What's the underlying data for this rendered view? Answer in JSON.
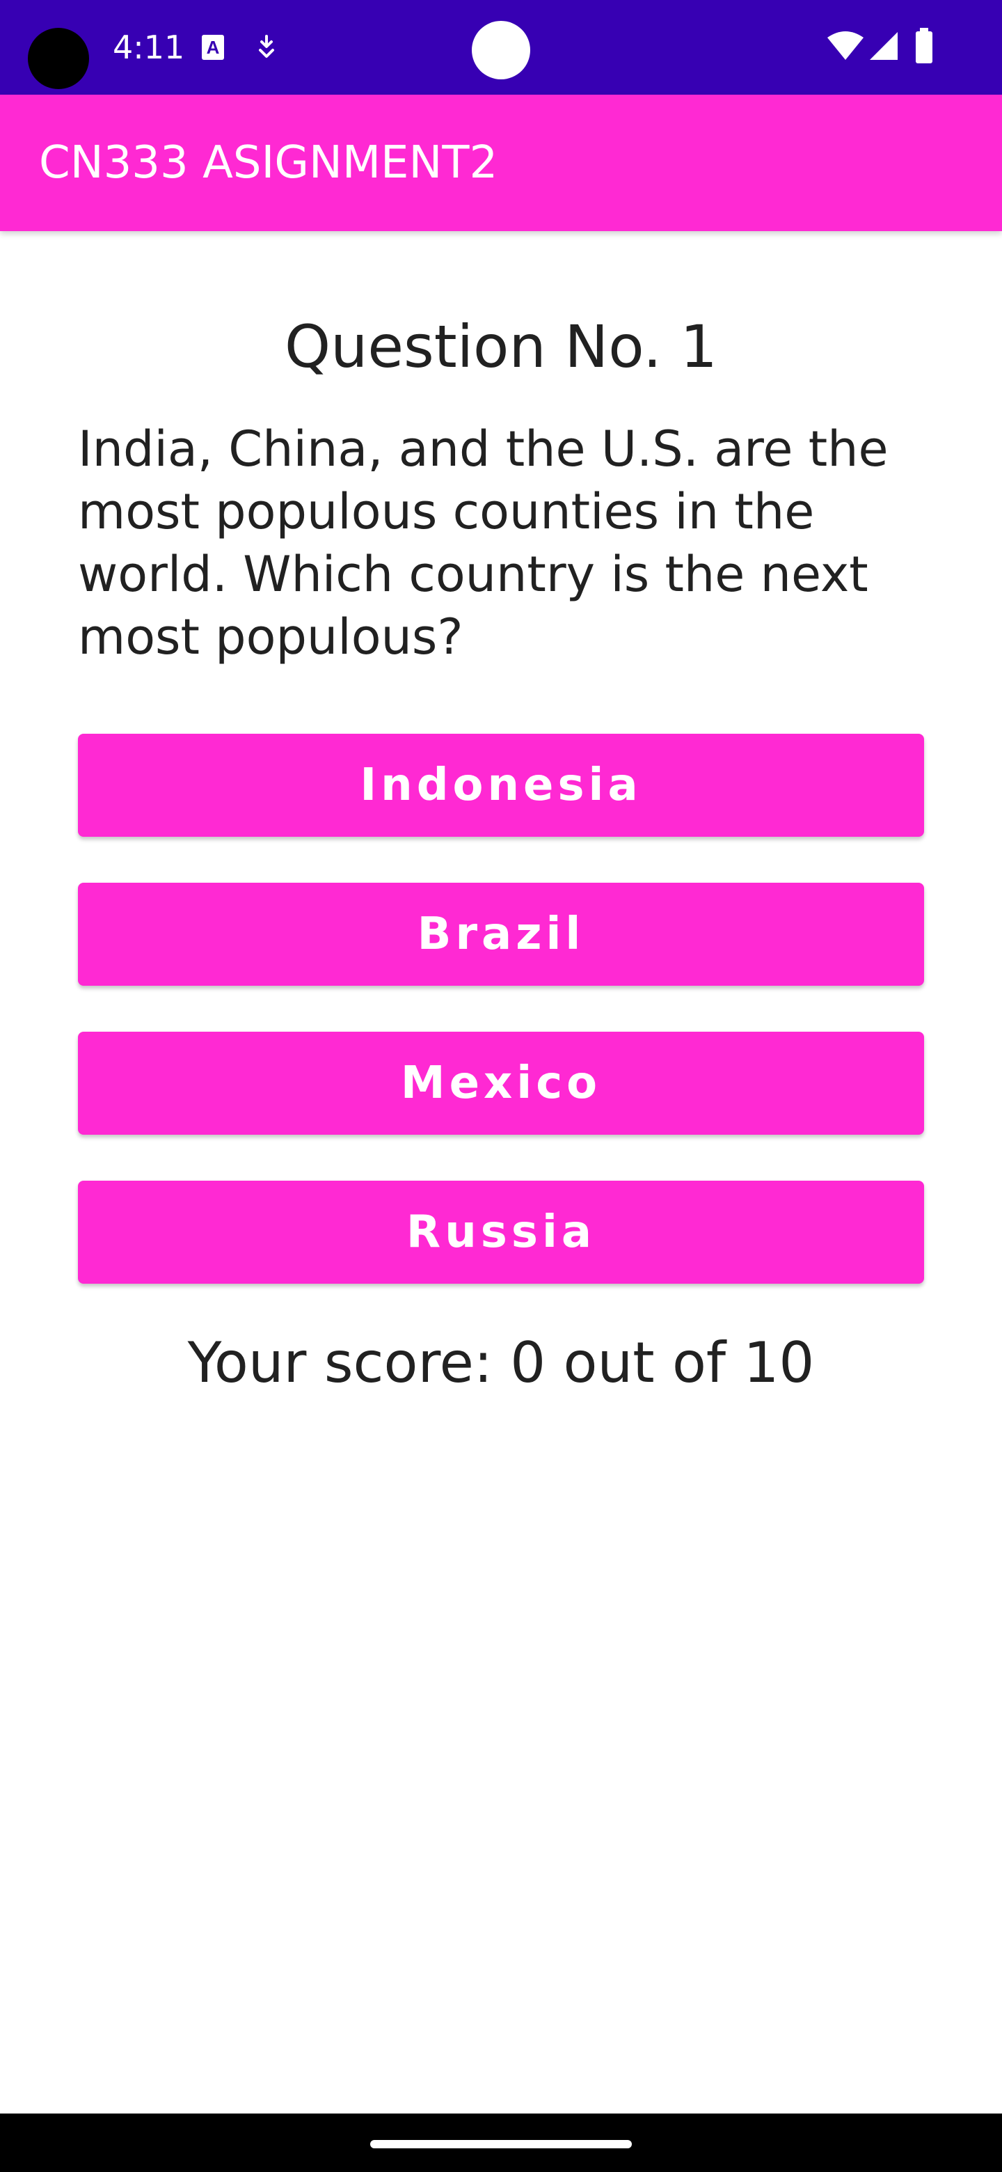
{
  "status_bar": {
    "time": "4:11",
    "background_color": "#3700b3",
    "icons": [
      "camera-hole",
      "a-notification-icon",
      "download-notification-icon",
      "center-dot",
      "wifi-icon",
      "signal-icon",
      "battery-icon"
    ]
  },
  "app_bar": {
    "title": "CN333 ASIGNMENT2",
    "background_color": "#ff29d3"
  },
  "quiz": {
    "question_number": "Question No. 1",
    "question_text": "India, China, and the U.S. are the most populous counties in the world.  Which country is the next most populous?",
    "answers": [
      {
        "label": "Indonesia"
      },
      {
        "label": "Brazil"
      },
      {
        "label": "Mexico"
      },
      {
        "label": "Russia"
      }
    ],
    "score_text": "Your score: 0 out of 10"
  },
  "colors": {
    "accent": "#ff29d3",
    "primary_dark": "#3700b3",
    "text": "#212121"
  }
}
